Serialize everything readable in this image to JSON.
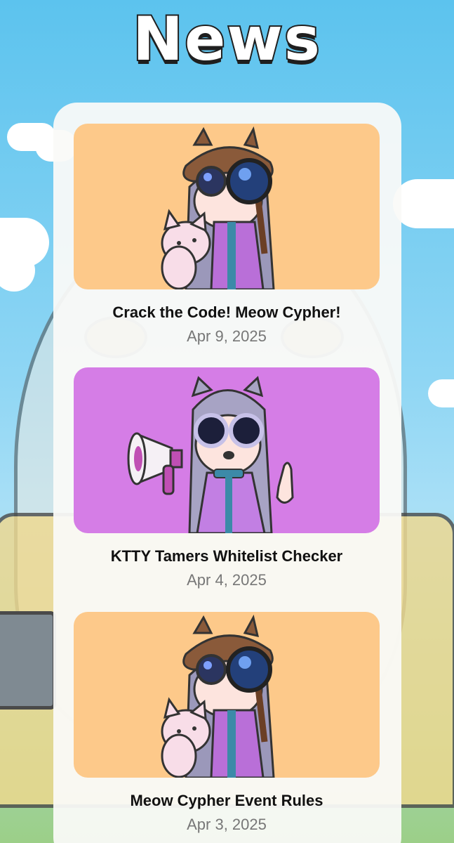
{
  "header": {
    "title": "News"
  },
  "news": [
    {
      "title": "Crack the Code! Meow Cypher!",
      "date": "Apr 9, 2025",
      "image_bg": "#fdc98a",
      "variant": "detective"
    },
    {
      "title": "KTTY Tamers Whitelist Checker",
      "date": "Apr 4, 2025",
      "image_bg": "#d57de6",
      "variant": "megaphone"
    },
    {
      "title": "Meow Cypher Event Rules",
      "date": "Apr 3, 2025",
      "image_bg": "#fdc98a",
      "variant": "detective"
    }
  ],
  "colors": {
    "sky": "#5cc3ee",
    "panel": "#fafaf8",
    "title_text": "#111111",
    "date_text": "#777777"
  }
}
